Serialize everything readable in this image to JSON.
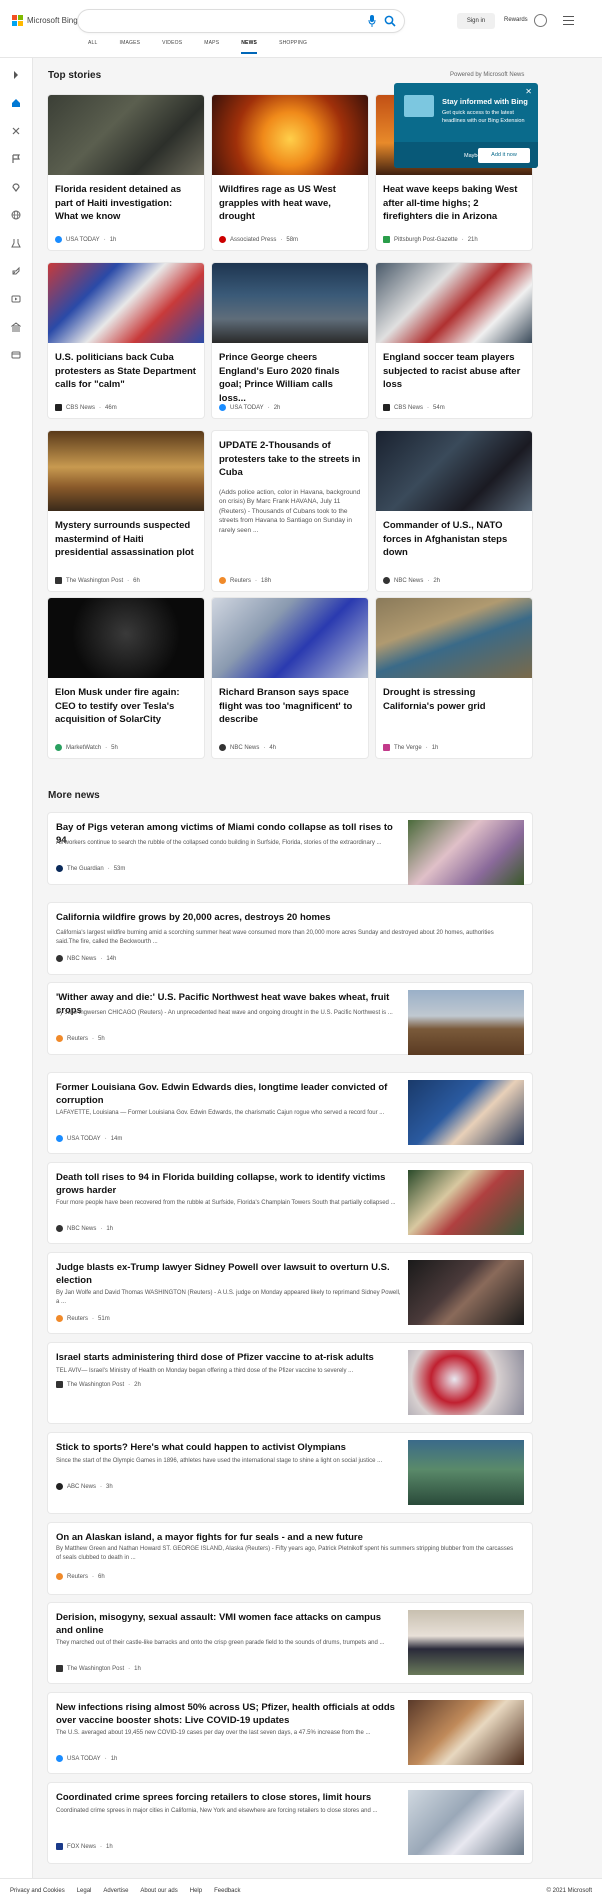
{
  "header": {
    "logo_text": "Microsoft Bing",
    "signin": "Sign in",
    "rewards": "Rewards",
    "tabs": [
      "ALL",
      "IMAGES",
      "VIDEOS",
      "MAPS",
      "NEWS",
      "SHOPPING"
    ],
    "active_tab": "NEWS"
  },
  "top_stories": {
    "title": "Top stories",
    "powered": "Powered by Microsoft News",
    "cards": [
      {
        "title": "Florida resident detained as part of Haiti investigation: What we know",
        "source": "USA TODAY",
        "time": "1h"
      },
      {
        "title": "Wildfires rage as US West grapples with heat wave, drought",
        "source": "Associated Press",
        "time": "58m"
      },
      {
        "title": "Heat wave keeps baking West after all-time highs; 2 firefighters die in Arizona",
        "source": "Pittsburgh Post-Gazette",
        "time": "21h"
      },
      {
        "title": "U.S. politicians back Cuba protesters as State Department calls for \"calm\"",
        "source": "CBS News",
        "time": "46m"
      },
      {
        "title": "Prince George cheers England's Euro 2020 finals goal; Prince William calls loss...",
        "source": "USA TODAY",
        "time": "2h"
      },
      {
        "title": "England soccer team players subjected to racist abuse after loss",
        "source": "CBS News",
        "time": "54m"
      },
      {
        "title": "Mystery surrounds suspected mastermind of Haiti presidential assassination plot",
        "source": "The Washington Post",
        "time": "6h"
      },
      {
        "title": "UPDATE 2-Thousands of protesters take to the streets in Cuba",
        "desc": "(Adds police action, color in Havana, background on crisis) By Marc Frank HAVANA, July 11 (Reuters) - Thousands of Cubans took to the streets from Havana to Santiago on Sunday in rarely seen ...",
        "source": "Reuters",
        "time": "18h"
      },
      {
        "title": "Commander of U.S., NATO forces in Afghanistan steps down",
        "source": "NBC News",
        "time": "2h"
      },
      {
        "title": "Elon Musk under fire again: CEO to testify over Tesla's acquisition of SolarCity",
        "source": "MarketWatch",
        "time": "5h"
      },
      {
        "title": "Richard Branson says space flight was too 'magnificent' to describe",
        "source": "NBC News",
        "time": "4h"
      },
      {
        "title": "Drought is stressing California's power grid",
        "source": "The Verge",
        "time": "1h"
      }
    ]
  },
  "popup": {
    "title": "Stay informed with Bing",
    "body": "Get quick access to the latest headlines with our Bing Extension",
    "close": "✕",
    "maybe": "Maybe later",
    "add": "Add it now"
  },
  "more_news": {
    "title": "More news",
    "items": [
      {
        "title": "Bay of Pigs veteran among victims of Miami condo collapse as toll rises to 94",
        "snippet": "As workers continue to search the rubble of the collapsed condo building in Surfside, Florida, stories of the extraordinary ...",
        "source": "The Guardian",
        "time": "53m"
      },
      {
        "title": "California wildfire grows by 20,000 acres, destroys 20 homes",
        "snippet": "California's largest wildfire burning amid a scorching summer heat wave consumed more than 20,000 more acres Sunday and destroyed about 20 homes, authorities said.The fire, called the Beckwourth ...",
        "source": "NBC News",
        "time": "14h"
      },
      {
        "title": "'Wither away and die:' U.S. Pacific Northwest heat wave bakes wheat, fruit crops",
        "snippet": "By Julie Ingwersen CHICAGO (Reuters) - An unprecedented heat wave and ongoing drought in the U.S. Pacific Northwest is ...",
        "source": "Reuters",
        "time": "5h"
      },
      {
        "title": "Former Louisiana Gov. Edwin Edwards dies, longtime leader convicted of corruption",
        "snippet": "LAFAYETTE, Louisiana — Former Louisiana Gov. Edwin Edwards, the charismatic Cajun rogue who served a record four ...",
        "source": "USA TODAY",
        "time": "14m"
      },
      {
        "title": "Death toll rises to 94 in Florida building collapse, work to identify victims grows harder",
        "snippet": "Four more people have been recovered from the rubble at Surfside, Florida's Champlain Towers South that partially collapsed ...",
        "source": "NBC News",
        "time": "1h"
      },
      {
        "title": "Judge blasts ex-Trump lawyer Sidney Powell over lawsuit to overturn U.S. election",
        "snippet": "By Jan Wolfe and David Thomas WASHINGTON (Reuters) - A U.S. judge on Monday appeared likely to reprimand Sidney Powell, a ...",
        "source": "Reuters",
        "time": "51m"
      },
      {
        "title": "Israel starts administering third dose of Pfizer vaccine to at-risk adults",
        "snippet": "TEL AVIV— Israel's Ministry of Health on Monday began offering a third dose of the Pfizer vaccine to severely ...",
        "source": "The Washington Post",
        "time": "2h"
      },
      {
        "title": "Stick to sports? Here's what could happen to activist Olympians",
        "snippet": "Since the start of the Olympic Games in 1896, athletes have used the international stage to shine a light on social justice ...",
        "source": "ABC News",
        "time": "3h"
      },
      {
        "title": "On an Alaskan island, a mayor fights for fur seals - and a new future",
        "snippet": "By Matthew Green and Nathan Howard ST. GEORGE ISLAND, Alaska (Reuters) - Fifty years ago, Patrick Pletnikoff spent his summers stripping blubber from the carcasses of seals clubbed to death in ...",
        "source": "Reuters",
        "time": "6h"
      },
      {
        "title": "Derision, misogyny, sexual assault: VMI women face attacks on campus and online",
        "snippet": "They marched out of their castle-like barracks and onto the crisp green parade field to the sounds of drums, trumpets and ...",
        "source": "The Washington Post",
        "time": "1h"
      },
      {
        "title": "New infections rising almost 50% across US; Pfizer, health officials at odds over vaccine booster shots: Live COVID-19 updates",
        "snippet": "The U.S. averaged about 19,455 new COVID-19 cases per day over the last seven days, a 47.5% increase from the ...",
        "source": "USA TODAY",
        "time": "1h"
      },
      {
        "title": "Coordinated crime sprees forcing retailers to close stores, limit hours",
        "snippet": "Coordinated crime sprees in major cities in California, New York and elsewhere are forcing retailers to close stores and ...",
        "source": "FOX News",
        "time": "1h"
      }
    ]
  },
  "footer": {
    "links": [
      "Privacy and Cookies",
      "Legal",
      "Advertise",
      "About our ads",
      "Help",
      "Feedback"
    ],
    "copyright": "© 2021 Microsoft"
  }
}
